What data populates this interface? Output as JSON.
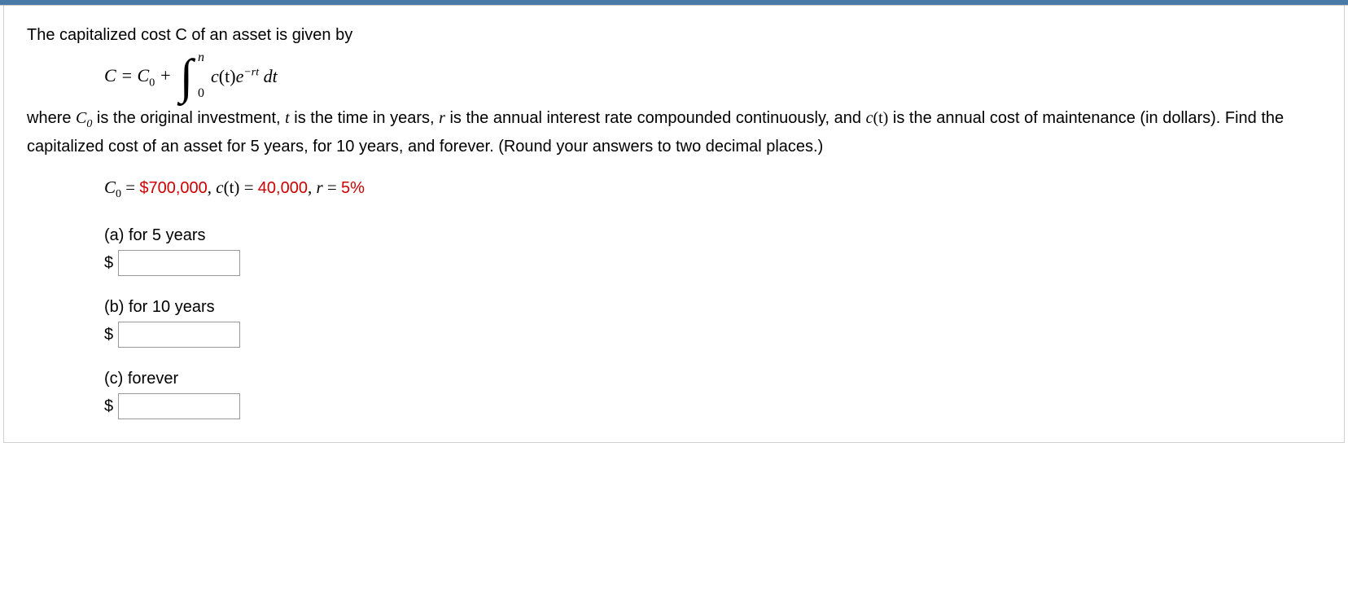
{
  "intro": "The capitalized cost C of an asset is given by",
  "formula": {
    "lhs_c": "C",
    "eq": " = ",
    "c0": "C",
    "c0_sub": "0",
    "plus": " + ",
    "int_upper": "n",
    "int_lower": "0",
    "integrand_c": "c",
    "integrand_paren": "(t)",
    "integrand_e": "e",
    "integrand_exp": "−rt",
    "integrand_dt": " dt"
  },
  "desc_parts": {
    "p1": "where  ",
    "c0": "C",
    "c0_sub": "0",
    "p2": "  is the original investment, ",
    "t": "t",
    "p3": " is the time in years, ",
    "r": "r",
    "p4": " is the annual interest rate compounded continuously, and ",
    "ct": "c",
    "ct_paren": "(t)",
    "p5": "  is the annual cost of maintenance (in dollars). Find the capitalized cost of an asset for 5 years, for 10 years, and forever. (Round your answers to two decimal places.)"
  },
  "given": {
    "c0": "C",
    "c0_sub": "0",
    "eq1": " = ",
    "val1": "$700,000",
    "comma1": ", ",
    "ct": "c",
    "ct_paren": "(t)",
    "eq2": " = ",
    "val2": "40,000",
    "comma2": ", ",
    "r": "r",
    "eq3": " = ",
    "val3": "5%"
  },
  "parts": {
    "a_label": "(a) for 5 years",
    "b_label": "(b) for 10 years",
    "c_label": "(c) forever",
    "dollar": "$"
  }
}
